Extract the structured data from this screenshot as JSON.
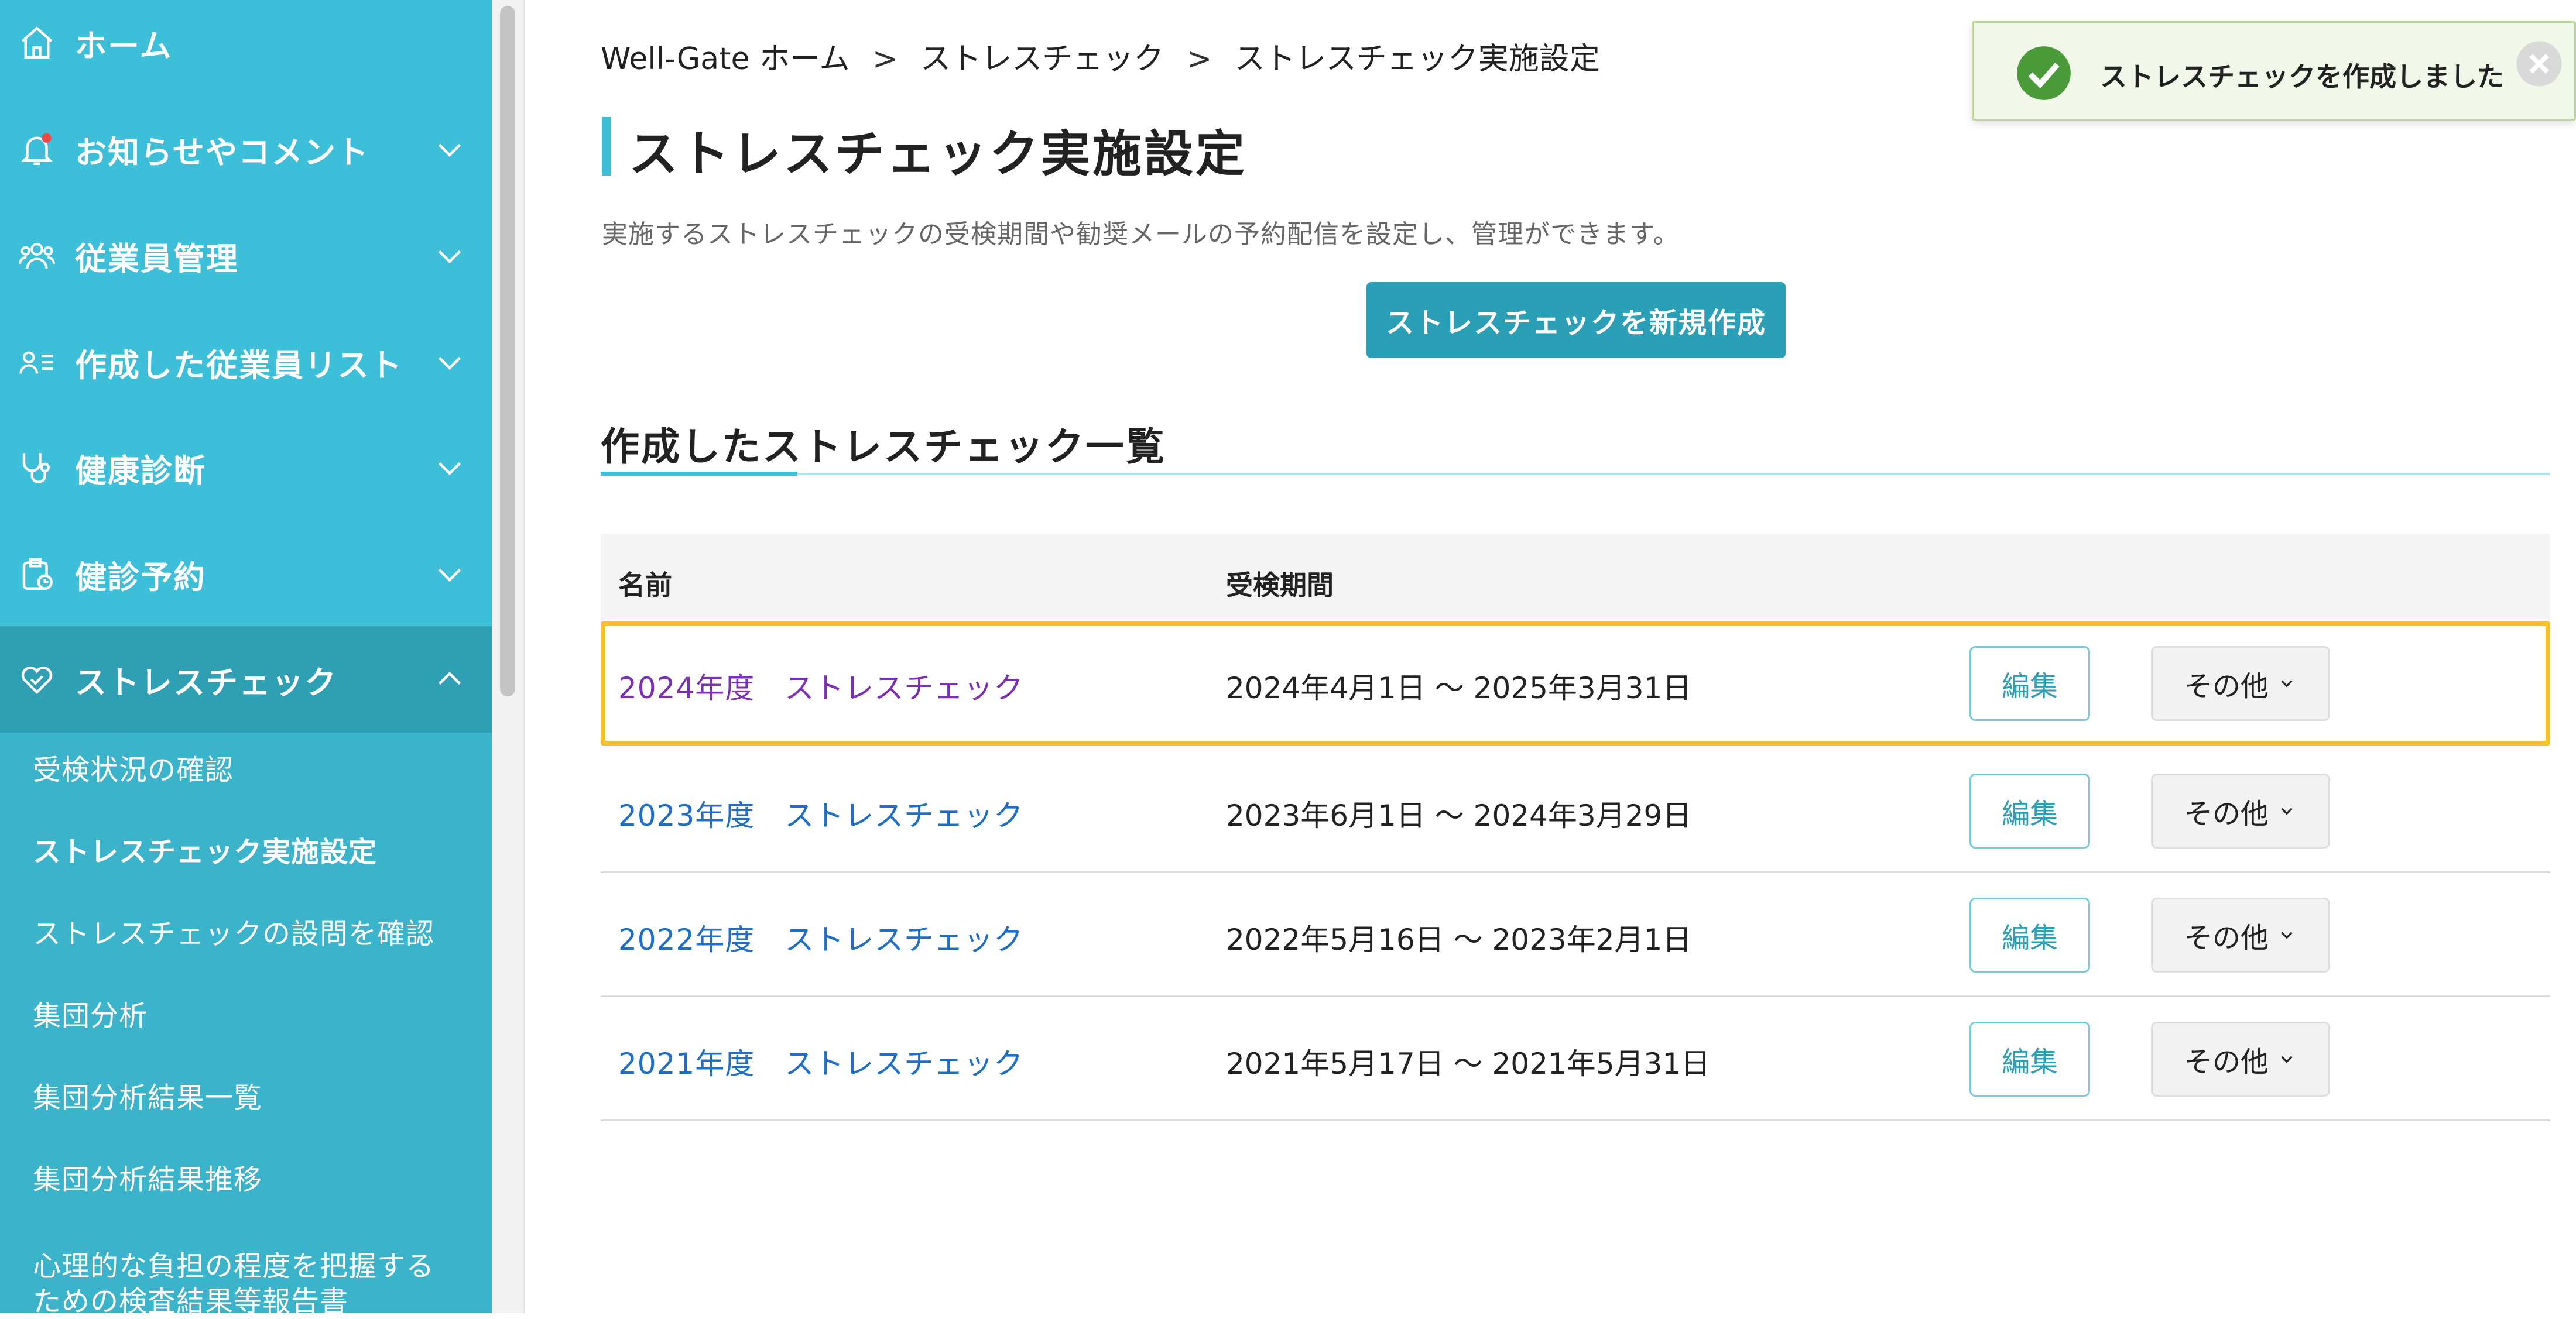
{
  "sidebar": {
    "items": [
      {
        "label": "ホーム",
        "icon": "home-icon"
      },
      {
        "label": "お知らせやコメント",
        "icon": "bell-icon"
      },
      {
        "label": "従業員管理",
        "icon": "people-icon"
      },
      {
        "label": "作成した従業員リスト",
        "icon": "user-list-icon"
      },
      {
        "label": "健康診断",
        "icon": "stethoscope-icon"
      },
      {
        "label": "健診予約",
        "icon": "clipboard-calendar-icon"
      },
      {
        "label": "ストレスチェック",
        "icon": "heart-icon"
      }
    ],
    "submenu": [
      "受検状況の確認",
      "ストレスチェック実施設定",
      "ストレスチェックの設問を確認",
      "集団分析",
      "集団分析結果一覧",
      "集団分析結果推移",
      "心理的な負担の程度を把握する",
      "ための検査結果等報告書"
    ],
    "colors": {
      "bg": "#3dbfd9",
      "active": "#2f9fb4"
    }
  },
  "breadcrumb": {
    "items": [
      "Well-Gate ホーム",
      "ストレスチェック",
      "ストレスチェック実施設定"
    ],
    "separator": ">"
  },
  "page": {
    "title": "ストレスチェック実施設定",
    "description": "実施するストレスチェックの受検期間や勧奨メールの予約配信を設定し、管理ができます。",
    "create_button": "ストレスチェックを新規作成",
    "section_title": "作成したストレスチェック一覧"
  },
  "table": {
    "headers": {
      "name": "名前",
      "period": "受検期間"
    },
    "rows": [
      {
        "name": "2024年度　ストレスチェック",
        "period": "2024年4月1日 〜 2025年3月31日",
        "edit": "編集",
        "more": "その他"
      },
      {
        "name": "2023年度　ストレスチェック",
        "period": "2023年6月1日 〜 2024年3月29日",
        "edit": "編集",
        "more": "その他"
      },
      {
        "name": "2022年度　ストレスチェック",
        "period": "2022年5月16日 〜 2023年2月1日",
        "edit": "編集",
        "more": "その他"
      },
      {
        "name": "2021年度　ストレスチェック",
        "period": "2021年5月17日 〜 2021年5月31日",
        "edit": "編集",
        "more": "その他"
      }
    ]
  },
  "toast": {
    "message": "ストレスチェックを作成しました",
    "icon": "check-circle-icon"
  },
  "colors": {
    "accent": "#3dbfd9",
    "button": "#2a9fb5",
    "link": "#1f6fc8",
    "visited_link": "#7a2fb5",
    "highlight": "#f7c02a",
    "toast_bg": "#f1f8e9",
    "toast_check": "#4a9a3a"
  }
}
